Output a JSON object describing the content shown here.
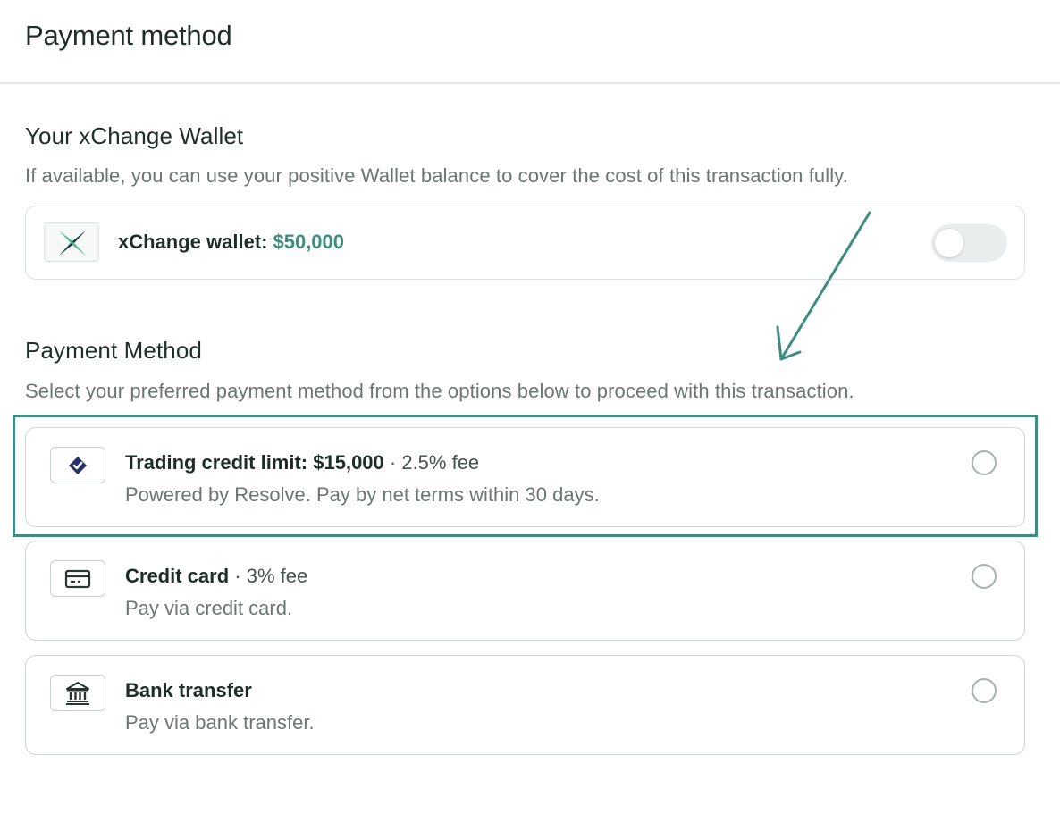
{
  "header": {
    "title": "Payment method"
  },
  "wallet_section": {
    "title": "Your xChange Wallet",
    "description": "If available, you can use your positive Wallet balance to cover the cost of this transaction fully.",
    "card": {
      "label": "xChange wallet:",
      "amount": "$50,000",
      "toggle_on": false
    }
  },
  "payment_section": {
    "title": "Payment Method",
    "description": "Select your preferred payment method from the options below to proceed with this transaction.",
    "options": [
      {
        "title": "Trading credit limit: $15,000",
        "fee": " · 2.5% fee",
        "description": "Powered by Resolve. Pay by net terms within 30 days.",
        "icon": "resolve-logo-icon",
        "selected": false
      },
      {
        "title": "Credit card",
        "fee": " · 3% fee",
        "description": "Pay via credit card.",
        "icon": "credit-card-icon",
        "selected": false
      },
      {
        "title": "Bank transfer",
        "fee": "",
        "description": "Pay via bank transfer.",
        "icon": "bank-icon",
        "selected": false
      }
    ]
  },
  "colors": {
    "accent": "#3d8f80",
    "highlight": "#3e8c82",
    "brand_navy": "#25316b"
  }
}
